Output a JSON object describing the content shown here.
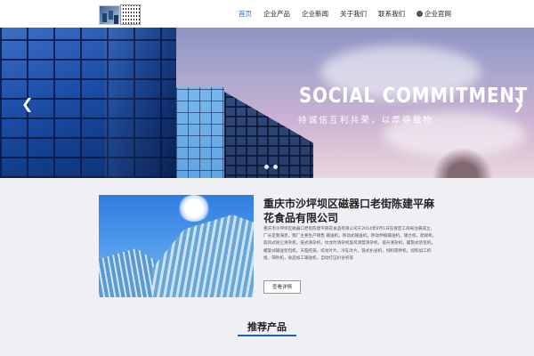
{
  "header": {
    "nav": [
      {
        "label": "首页",
        "active": true
      },
      {
        "label": "企业产品"
      },
      {
        "label": "企业新闻"
      },
      {
        "label": "关于我们"
      },
      {
        "label": "联系我们"
      },
      {
        "label": "企业官网",
        "icon": "globe-icon"
      }
    ]
  },
  "banner": {
    "headline": "SOCIAL COMMITMENT",
    "subline": "持诚信互利共荣，以厚德载物",
    "slides": 2
  },
  "company": {
    "title": "重庆市沙坪坝区磁器口老街陈建平麻花食品有限公司",
    "description": "重庆市沙坪坝区磁器口老街陈建平麻花食品有限公司于2014年9月1日在保定工商局注册成立，广长是我海星，我厂主要生产销售 输送机，移动式输送机，移动伸缩输送机，储仓机，爬梯机，旋风式除尘清杂机，链式清杂机，纹龙时清杂机旋风清慧清杂机，提升清杂机，螺旋式装包机，螺旋式输送装包机，天脑绞笼，绞龙叶片，冷轧叶片，链式扒谷机，饲料搅拌机，饲料加工机组，筛秒机，食品加工输送机，自动打压扒谷机等",
    "more_label": "查看详情"
  },
  "products": {
    "title": "推荐产品"
  },
  "colors": {
    "accent": "#1f5fb4",
    "nav_active": "#2b6cc4"
  }
}
